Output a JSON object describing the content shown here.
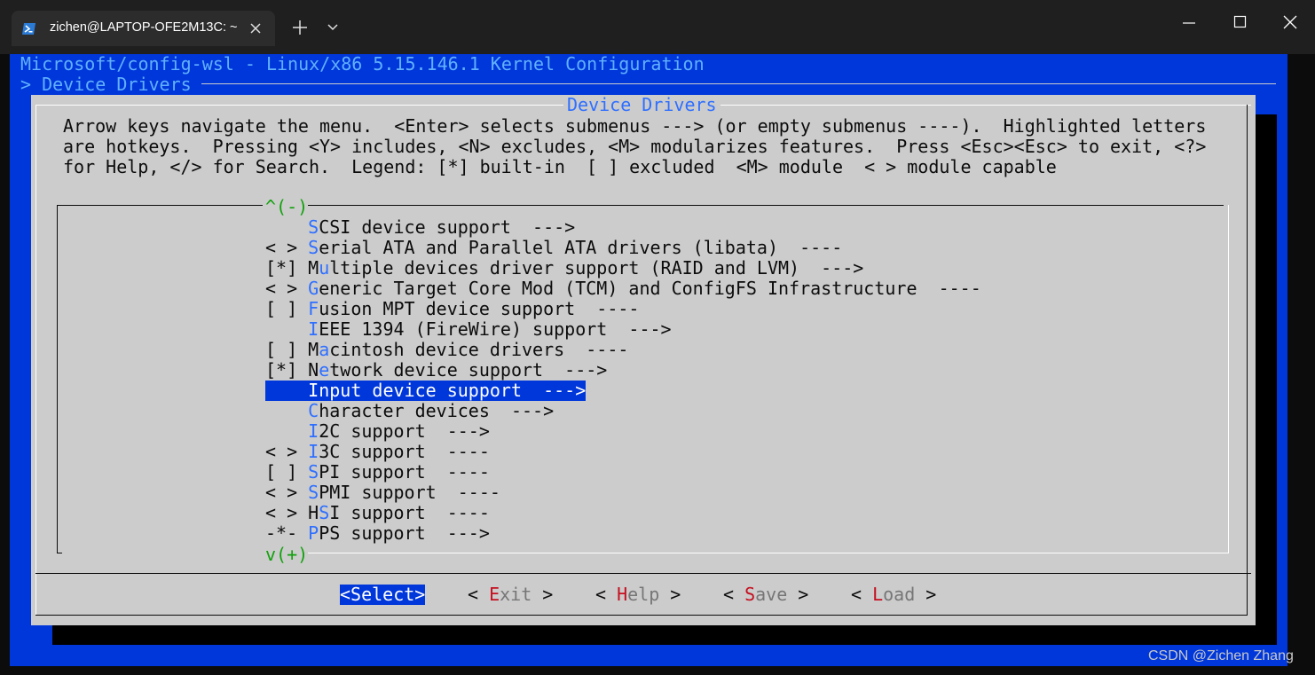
{
  "window": {
    "tab_title": "zichen@LAPTOP-OFE2M13C: ~",
    "icons": [
      "powershell-icon",
      "close-icon",
      "plus-icon",
      "chevron-down-icon",
      "minimize-icon",
      "maximize-icon",
      "close-window-icon"
    ]
  },
  "terminal": {
    "title_line": "Microsoft/config-wsl - Linux/x86 5.15.146.1 Kernel Configuration",
    "breadcrumb": "> Device Drivers",
    "dialog_title": "Device Drivers",
    "help_lines": [
      "Arrow keys navigate the menu.  <Enter> selects submenus ---> (or empty submenus ----).  Highlighted letters",
      "are hotkeys.  Pressing <Y> includes, <N> excludes, <M> modularizes features.  Press <Esc><Esc> to exit, <?>",
      "for Help, </> for Search.  Legend: [*] built-in  [ ] excluded  <M> module  < > module capable"
    ],
    "scroll_up": "^(-)",
    "scroll_down": "v(+)",
    "menu_items": [
      {
        "prefix": "    ",
        "pre": "",
        "hotkey": "S",
        "post": "CSI device support  --->",
        "selected": false
      },
      {
        "prefix": "< > ",
        "pre": "",
        "hotkey": "S",
        "post": "erial ATA and Parallel ATA drivers (libata)  ----",
        "selected": false
      },
      {
        "prefix": "[*] ",
        "pre": "M",
        "hotkey": "u",
        "post": "ltiple devices driver support (RAID and LVM)  --->",
        "selected": false
      },
      {
        "prefix": "< > ",
        "pre": "",
        "hotkey": "G",
        "post": "eneric Target Core Mod (TCM) and ConfigFS Infrastructure  ----",
        "selected": false
      },
      {
        "prefix": "[ ] ",
        "pre": "",
        "hotkey": "F",
        "post": "usion MPT device support  ----",
        "selected": false
      },
      {
        "prefix": "    ",
        "pre": "",
        "hotkey": "I",
        "post": "EEE 1394 (FireWire) support  --->",
        "selected": false
      },
      {
        "prefix": "[ ] ",
        "pre": "M",
        "hotkey": "a",
        "post": "cintosh device drivers  ----",
        "selected": false
      },
      {
        "prefix": "[*] ",
        "pre": "N",
        "hotkey": "e",
        "post": "twork device support  --->",
        "selected": false
      },
      {
        "prefix": "    ",
        "pre": "",
        "hotkey": "I",
        "post": "nput device support  --->",
        "selected": true
      },
      {
        "prefix": "    ",
        "pre": "",
        "hotkey": "C",
        "post": "haracter devices  --->",
        "selected": false
      },
      {
        "prefix": "    ",
        "pre": "",
        "hotkey": "I",
        "post": "2C support  --->",
        "selected": false
      },
      {
        "prefix": "< > ",
        "pre": "",
        "hotkey": "I",
        "post": "3C support  ----",
        "selected": false
      },
      {
        "prefix": "[ ] ",
        "pre": "",
        "hotkey": "S",
        "post": "PI support  ----",
        "selected": false
      },
      {
        "prefix": "< > ",
        "pre": "",
        "hotkey": "S",
        "post": "PMI support  ----",
        "selected": false
      },
      {
        "prefix": "< > ",
        "pre": "H",
        "hotkey": "S",
        "post": "I support  ----",
        "selected": false
      },
      {
        "prefix": "-*- ",
        "pre": "",
        "hotkey": "P",
        "post": "PS support  --->",
        "selected": false
      }
    ],
    "buttons": [
      {
        "label": "<Select>",
        "open": "<",
        "hotkey": "",
        "rest": "Select",
        "close": ">",
        "selected": true
      },
      {
        "label": "< Exit >",
        "open": "< ",
        "hotkey": "E",
        "rest": "xit",
        "close": " >",
        "selected": false
      },
      {
        "label": "< Help >",
        "open": "< ",
        "hotkey": "H",
        "rest": "elp",
        "close": " >",
        "selected": false
      },
      {
        "label": "< Save >",
        "open": "< ",
        "hotkey": "S",
        "rest": "ave",
        "close": " >",
        "selected": false
      },
      {
        "label": "< Load >",
        "open": "< ",
        "hotkey": "L",
        "rest": "oad",
        "close": " >",
        "selected": false
      }
    ]
  },
  "watermark": "CSDN @Zichen Zhang"
}
